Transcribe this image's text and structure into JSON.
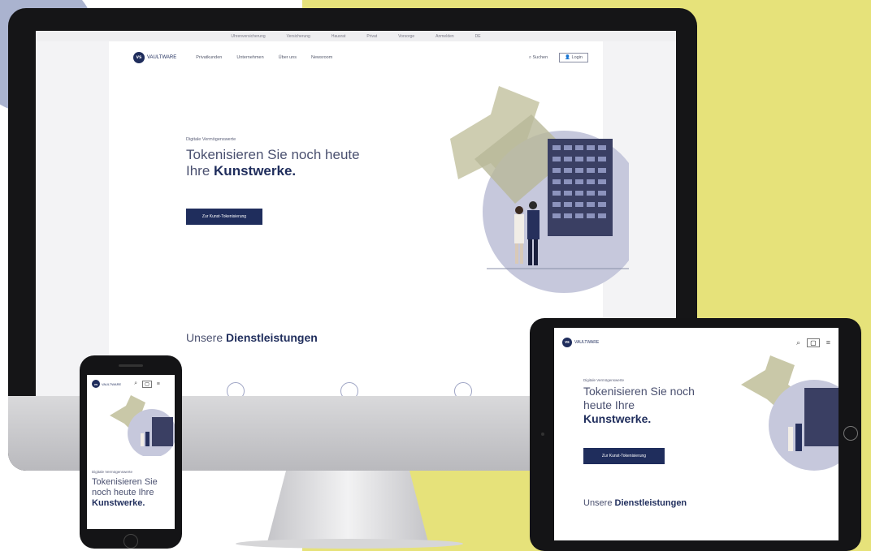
{
  "desktop": {
    "browser_tabs": [
      "Uhrenversicherung",
      "Versicherung",
      "Hausrat",
      "Privat",
      "Vorsorge",
      "Anmelden",
      "DE"
    ],
    "logo_mark": "vs",
    "logo_text": "VAULTWARE",
    "nav": [
      "Privatkunden",
      "Unternehmen",
      "Über uns",
      "Newsroom"
    ],
    "search_label": "Suchen",
    "login_label": "Login",
    "eyebrow": "Digitale Vermögenswerte",
    "headline_light": "Tokenisieren Sie noch heute Ihre ",
    "headline_bold": "Kunstwerke.",
    "cta_label": "Zur Kunst-Tokenisierung",
    "section_light": "Unsere ",
    "section_bold": "Dienstleistungen"
  },
  "tablet": {
    "logo_mark": "vs",
    "logo_text": "VAULTWARE",
    "eyebrow": "Digitale Vermögenswerte",
    "headline_light": "Tokenisieren Sie noch heute Ihre",
    "headline_bold": "Kunstwerke.",
    "cta_label": "Zur Kunst-Tokenisierung",
    "section_light": "Unsere ",
    "section_bold": "Dienstleistungen"
  },
  "phone": {
    "logo_mark": "vs",
    "logo_text": "VAULTWARE",
    "eyebrow": "Digitale Vermögenswerte",
    "headline_light": "Tokenisieren Sie noch heute Ihre",
    "headline_bold": "Kunstwerke."
  },
  "colors": {
    "navy": "#1f2d5c",
    "yellow_bg": "#e6e27a",
    "blue_bg": "#aab3cf",
    "art_circle": "#c6c8dc"
  }
}
